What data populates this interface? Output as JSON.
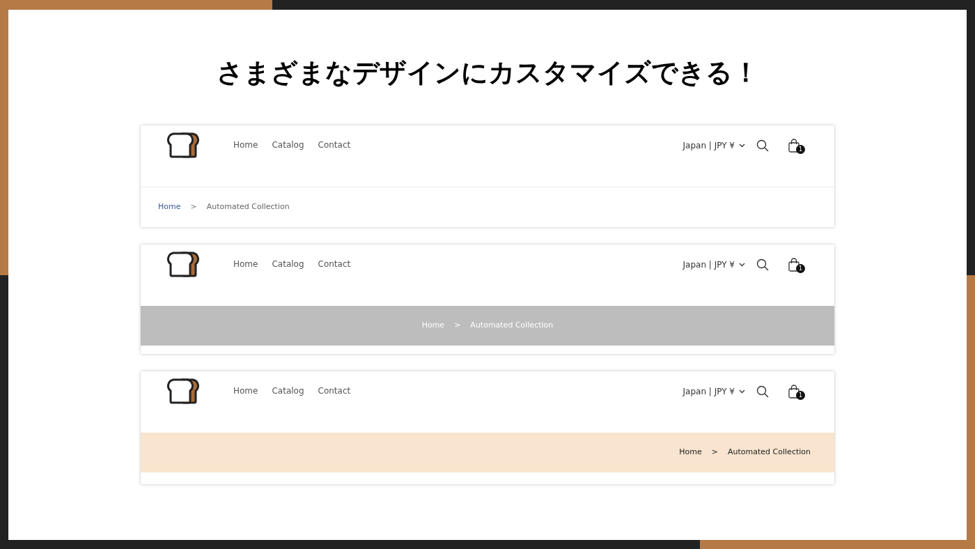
{
  "title": "さまざまなデザインにカスタマイズできる！",
  "previews": [
    {
      "kind": "plain",
      "nav": [
        "Home",
        "Catalog",
        "Contact"
      ],
      "locale": "Japan | JPY ¥",
      "cart_count": "1",
      "breadcrumb": {
        "home": "Home",
        "separator": ">",
        "current": "Automated Collection"
      }
    },
    {
      "kind": "gray",
      "nav": [
        "Home",
        "Catalog",
        "Contact"
      ],
      "locale": "Japan | JPY ¥",
      "cart_count": "1",
      "breadcrumb": {
        "home": "Home",
        "separator": ">",
        "current": "Automated Collection"
      }
    },
    {
      "kind": "peach",
      "nav": [
        "Home",
        "Catalog",
        "Contact"
      ],
      "locale": "Japan | JPY ¥",
      "cart_count": "1",
      "breadcrumb": {
        "home": "Home",
        "separator": ">",
        "current": "Automated Collection"
      }
    }
  ]
}
